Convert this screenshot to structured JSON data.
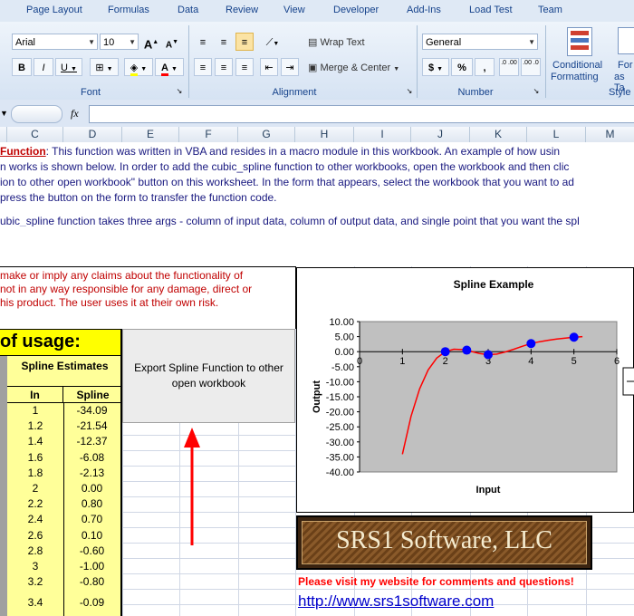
{
  "ribbon_tabs": [
    "Page Layout",
    "Formulas",
    "Data",
    "Review",
    "View",
    "Developer",
    "Add-Ins",
    "Load Test",
    "Team"
  ],
  "font_group": {
    "label": "Font",
    "font_name": "Arial",
    "font_size": "10",
    "bold": "B",
    "italic": "I",
    "underline": "U",
    "grow": "A",
    "shrink": "A"
  },
  "alignment_group": {
    "label": "Alignment",
    "wrap_text": "Wrap Text",
    "merge_center": "Merge & Center"
  },
  "number_group": {
    "label": "Number",
    "format": "General",
    "currency": "$",
    "percent": "%",
    "comma": ",",
    "inc_decimal": ".0 .00",
    "dec_decimal": ".00 .0"
  },
  "styles_group": {
    "label": "Style",
    "conditional": "Conditional",
    "formatting": "Formatting",
    "format_as": "For",
    "as_table": "as Ta"
  },
  "formula_bar": {
    "fx": "fx",
    "value": ""
  },
  "columns": [
    "C",
    "D",
    "E",
    "F",
    "G",
    "H",
    "I",
    "J",
    "K",
    "L",
    "M"
  ],
  "sheet": {
    "intro_bold": "Function",
    "intro_line1_rest": ":  This  function was written in VBA and resides in a macro module in this workbook.  An  example of how usin",
    "intro_line2": "n works is shown below.   In order to add the cubic_spline function to other workbooks, open the workbook and then clic",
    "intro_line3": "ion to other open workbook\" button on this worksheet.  In  the  form that appears, select the workbook that you want to ad",
    "intro_line4": " press the button on the form to transfer the function code.",
    "args_line": "ubic_spline function takes three args - column of input data, column of output data, and single point that you want the  spl",
    "disclaimer1": " make or imply any claims about the  functionality of",
    "disclaimer2": "not in any way responsible for any damage, direct or",
    "disclaimer3": "his product.  The user uses it at their own risk.",
    "usage_title": "of usage:",
    "spline_estimates": "Spline Estimates",
    "col_in": "In",
    "col_spline": "Spline",
    "rows": [
      {
        "in": "1",
        "spline": "-34.09"
      },
      {
        "in": "1.2",
        "spline": "-21.54"
      },
      {
        "in": "1.4",
        "spline": "-12.37"
      },
      {
        "in": "1.6",
        "spline": "-6.08"
      },
      {
        "in": "1.8",
        "spline": "-2.13"
      },
      {
        "in": "2",
        "spline": "0.00"
      },
      {
        "in": "2.2",
        "spline": "0.80"
      },
      {
        "in": "2.4",
        "spline": "0.70"
      },
      {
        "in": "2.6",
        "spline": "0.10"
      },
      {
        "in": "2.8",
        "spline": "-0.60"
      },
      {
        "in": "3",
        "spline": "-1.00"
      },
      {
        "in": "3.2",
        "spline": "-0.80"
      },
      {
        "in": "3.4",
        "spline": "-0.09"
      }
    ],
    "export_button": "Export Spline Function to other open workbook",
    "visit_text": "Please visit my website for comments and questions!",
    "website": "http://www.srs1software.com",
    "logo_text": "SRS1 Software, LLC"
  },
  "colors": {
    "yellow": "#ffff99",
    "title_yellow": "#ffff00",
    "red_text": "#c00000",
    "blue_text": "#17177f",
    "link": "#0000cc",
    "plot_bg": "#c0c0c0"
  },
  "chart_data": {
    "type": "scatter",
    "title": "Spline Example",
    "xlabel": "Input",
    "ylabel": "Output",
    "xlim": [
      0,
      6
    ],
    "ylim": [
      -40,
      10
    ],
    "x_ticks": [
      "0",
      "1",
      "2",
      "3",
      "4",
      "5",
      "6"
    ],
    "y_ticks": [
      "10.00",
      "5.00",
      "0.00",
      "-5.00",
      "-10.00",
      "-15.00",
      "-20.00",
      "-25.00",
      "-30.00",
      "-35.00",
      "-40.00"
    ],
    "series": [
      {
        "role": "points",
        "color": "#0000ff",
        "x": [
          2,
          2.5,
          3,
          4,
          5
        ],
        "y": [
          0,
          0.5,
          -1,
          2.7,
          4.8
        ]
      },
      {
        "role": "spline",
        "color": "#ff0000",
        "x": [
          1,
          1.2,
          1.4,
          1.6,
          1.8,
          2,
          2.2,
          2.4,
          2.6,
          2.8,
          3,
          3.2,
          3.4,
          3.6,
          3.8,
          4,
          4.2,
          4.4,
          4.6,
          4.8,
          5,
          5.2
        ],
        "y": [
          -34.09,
          -21.54,
          -12.37,
          -6.08,
          -2.13,
          0,
          0.8,
          0.7,
          0.1,
          -0.6,
          -1,
          -0.8,
          -0.09,
          0.8,
          1.8,
          2.7,
          3.3,
          3.8,
          4.2,
          4.5,
          4.8,
          5.0
        ]
      }
    ]
  }
}
